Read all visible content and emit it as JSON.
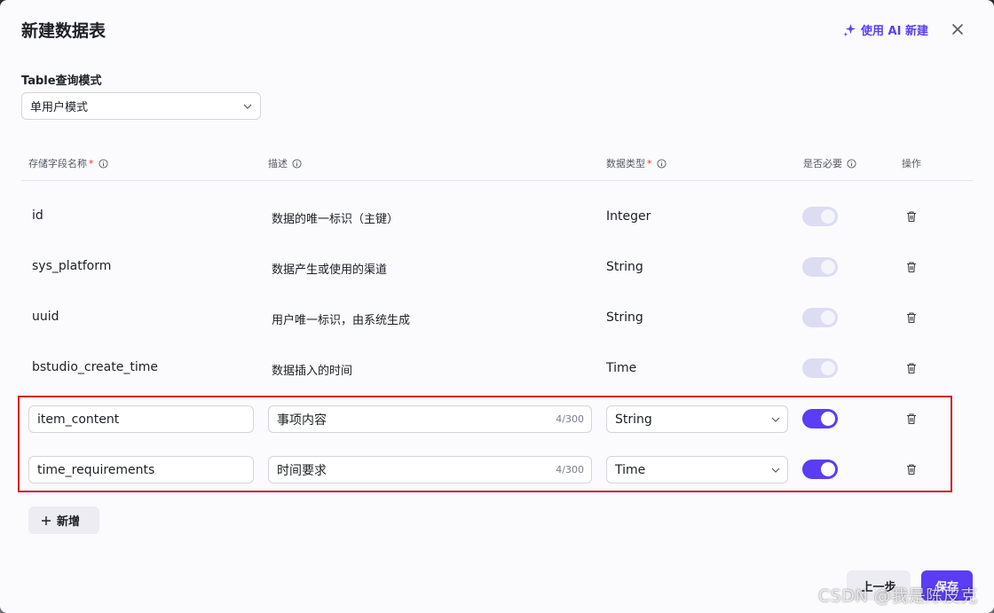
{
  "dialog": {
    "title": "新建数据表",
    "ai_button_label": "使用 AI 新建",
    "ai_icon": "sparkle-icon",
    "close_icon": "close-icon"
  },
  "mode": {
    "label": "Table查询模式",
    "selected": "单用户模式"
  },
  "columns": {
    "name": "存储字段名称",
    "desc": "描述",
    "type": "数据类型",
    "required": "是否必要",
    "action": "操作",
    "required_mark": "*"
  },
  "system_rows": [
    {
      "name": "id",
      "desc": "数据的唯一标识（主键）",
      "type": "Integer",
      "required": true
    },
    {
      "name": "sys_platform",
      "desc": "数据产生或使用的渠道",
      "type": "String",
      "required": true
    },
    {
      "name": "uuid",
      "desc": "用户唯一标识，由系统生成",
      "type": "String",
      "required": true
    },
    {
      "name": "bstudio_create_time",
      "desc": "数据插入的时间",
      "type": "Time",
      "required": true
    }
  ],
  "custom_rows": [
    {
      "name": "item_content",
      "desc": "事项内容",
      "counter": "4/300",
      "type": "String",
      "required": true
    },
    {
      "name": "time_requirements",
      "desc": "时间要求",
      "counter": "4/300",
      "type": "Time",
      "required": true
    }
  ],
  "add_button_label": "新增",
  "prev_button_label": "上一步",
  "save_button_label": "保存",
  "watermark": "CSDN @我是陈皮克",
  "colors": {
    "accent": "#5a3df5",
    "highlight": "#d21d24"
  }
}
